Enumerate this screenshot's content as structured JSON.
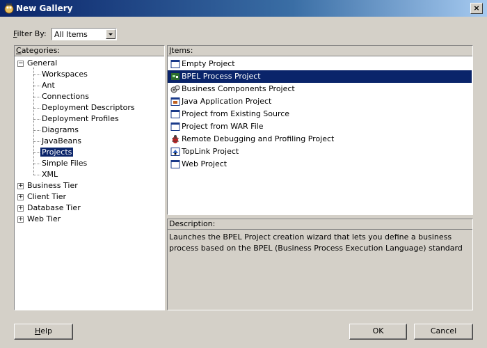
{
  "window": {
    "title": "New Gallery",
    "close_label": "×"
  },
  "filter": {
    "label": "Filter By:",
    "value": "All Items"
  },
  "categories": {
    "header": "Categories:",
    "general": "General",
    "general_children": [
      "Workspaces",
      "Ant",
      "Connections",
      "Deployment Descriptors",
      "Deployment Profiles",
      "Diagrams",
      "JavaBeans",
      "Projects",
      "Simple Files",
      "XML"
    ],
    "selected": "Projects",
    "collapsed": [
      "Business Tier",
      "Client Tier",
      "Database Tier",
      "Web Tier"
    ],
    "expanded_symbol": "−",
    "collapsed_symbol": "+"
  },
  "items": {
    "header": "Items:",
    "list": [
      {
        "label": "Empty Project",
        "icon": "window-icon"
      },
      {
        "label": "BPEL Process Project",
        "icon": "bpel-icon"
      },
      {
        "label": "Business Components Project",
        "icon": "gears-icon"
      },
      {
        "label": "Java Application Project",
        "icon": "java-app-icon"
      },
      {
        "label": "Project from Existing Source",
        "icon": "window-icon"
      },
      {
        "label": "Project from WAR File",
        "icon": "window-icon"
      },
      {
        "label": "Remote Debugging and Profiling Project",
        "icon": "bug-icon"
      },
      {
        "label": "TopLink Project",
        "icon": "toplink-icon"
      },
      {
        "label": "Web Project",
        "icon": "window-icon"
      }
    ],
    "selected": "BPEL Process Project"
  },
  "description": {
    "header": "Description:",
    "text": "Launches the BPEL Project creation wizard that lets you define a business process based on the BPEL (Business Process Execution Language) standard"
  },
  "buttons": {
    "help": "Help",
    "ok": "OK",
    "cancel": "Cancel"
  },
  "colors": {
    "selection": "#0a246a",
    "dialog_bg": "#d4d0c8"
  }
}
